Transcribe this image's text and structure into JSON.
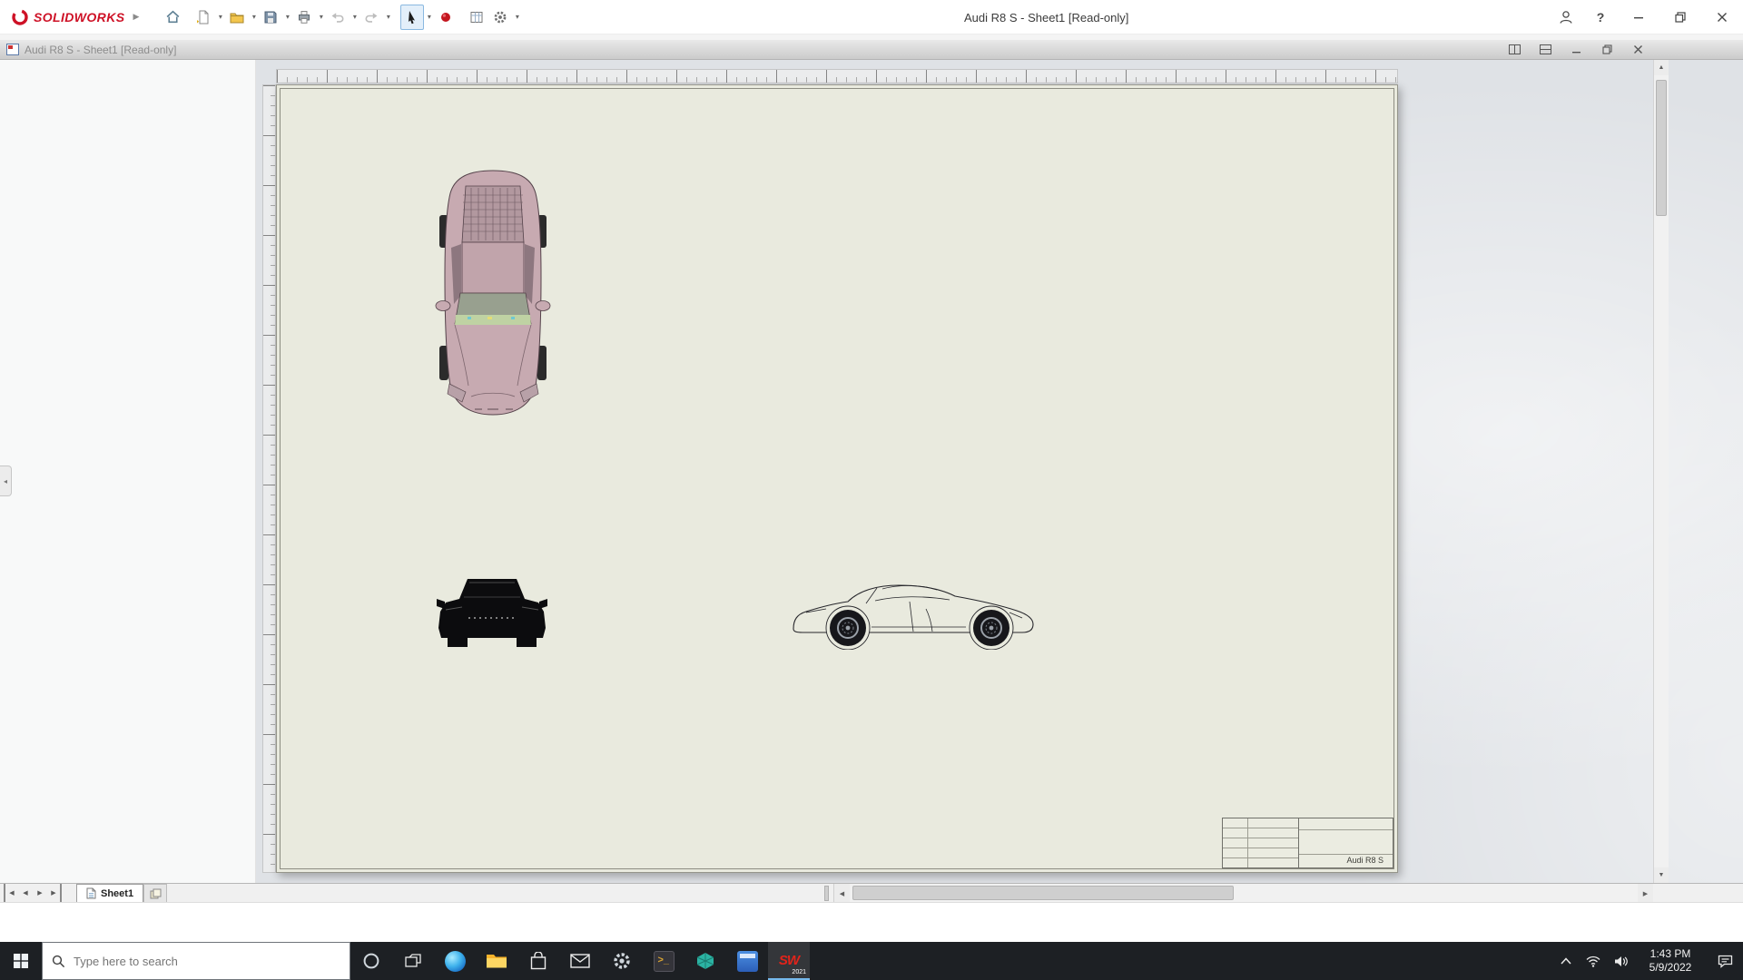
{
  "app": {
    "brand": "SOLIDWORKS",
    "title": "Audi R8 S - Sheet1 [Read-only]"
  },
  "doc_window": {
    "title": "Audi R8 S - Sheet1 [Read-only]"
  },
  "toolbar": {
    "buttons": [
      "home",
      "new-document",
      "open",
      "save",
      "print",
      "undo",
      "redo",
      "select",
      "mouse-gestures",
      "sheet-properties",
      "options"
    ]
  },
  "sheet": {
    "tab_label": "Sheet1",
    "title_block_part": "Audi R8 S"
  },
  "taskbar": {
    "search_placeholder": "Type here to search",
    "solidworks_mark": "SW",
    "solidworks_year": "2021",
    "time": "1:43 PM",
    "date": "5/9/2022"
  },
  "colors": {
    "brand_red": "#ce1126",
    "sheet_background": "#e9eade",
    "viewport_background": "#dfe2e6",
    "taskbar_background": "#1d2024",
    "active_tool_highlight": "#e3effa"
  }
}
